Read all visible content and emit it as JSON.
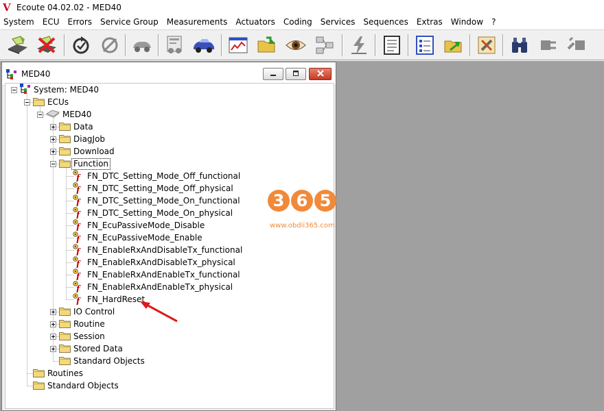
{
  "app": {
    "logo_letter": "V",
    "title": "Ecoute 04.02.02 - MED40"
  },
  "menu": [
    "System",
    "ECU",
    "Errors",
    "Service Group",
    "Measurements",
    "Actuators",
    "Coding",
    "Services",
    "Sequences",
    "Extras",
    "Window",
    "?"
  ],
  "toolbar": {
    "buttons": [
      {
        "icon": "connect-icon"
      },
      {
        "icon": "disconnect-icon"
      },
      {
        "icon": "refresh-icon"
      },
      {
        "icon": "auto-detect-icon"
      },
      {
        "icon": "vehicle-icon"
      },
      {
        "icon": "ecu-list-icon"
      },
      {
        "icon": "car-icon"
      },
      {
        "icon": "chart-icon"
      },
      {
        "icon": "open-folder-icon"
      },
      {
        "icon": "eye-icon"
      },
      {
        "icon": "network-icon"
      },
      {
        "icon": "flash-icon"
      },
      {
        "icon": "document-icon"
      },
      {
        "icon": "checklist-icon"
      },
      {
        "icon": "export-folder-icon"
      },
      {
        "icon": "tools-icon"
      },
      {
        "icon": "binoculars-icon"
      },
      {
        "icon": "plug-icon"
      },
      {
        "icon": "unplug-icon"
      }
    ]
  },
  "child_window": {
    "title": "MED40",
    "controls": [
      "minimize",
      "restore",
      "close"
    ]
  },
  "tree": {
    "system": "System: MED40",
    "ecus": "ECUs",
    "ecu": "MED40",
    "ecu_children": [
      "Data",
      "DiagJob",
      "Download",
      "Function"
    ],
    "functions": [
      "FN_DTC_Setting_Mode_Off_functional",
      "FN_DTC_Setting_Mode_Off_physical",
      "FN_DTC_Setting_Mode_On_functional",
      "FN_DTC_Setting_Mode_On_physical",
      "FN_EcuPassiveMode_Disable",
      "FN_EcuPassiveMode_Enable",
      "FN_EnableRxAndDisableTx_functional",
      "FN_EnableRxAndDisableTx_physical",
      "FN_EnableRxAndEnableTx_functional",
      "FN_EnableRxAndEnableTx_physical",
      "FN_HardReset"
    ],
    "ecu_after": [
      "IO Control",
      "Routine",
      "Session",
      "Stored Data",
      "Standard Objects"
    ],
    "system_after": [
      "Routines",
      "Standard Objects"
    ]
  },
  "watermark": {
    "digits": [
      "3",
      "6",
      "5"
    ],
    "url": "www.obdii365.com"
  },
  "colors": {
    "workspace": "#a0a0a0",
    "folder": "#f3d97a",
    "function_glyph": "#c00000",
    "arrow": "#e0191b",
    "watermark": "#f08a3a"
  }
}
